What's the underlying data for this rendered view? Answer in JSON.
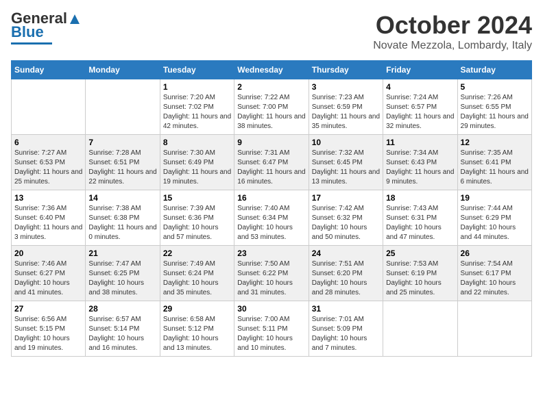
{
  "header": {
    "logo_general": "General",
    "logo_blue": "Blue",
    "month_title": "October 2024",
    "location": "Novate Mezzola, Lombardy, Italy"
  },
  "days_of_week": [
    "Sunday",
    "Monday",
    "Tuesday",
    "Wednesday",
    "Thursday",
    "Friday",
    "Saturday"
  ],
  "weeks": [
    [
      {
        "day": "",
        "info": ""
      },
      {
        "day": "",
        "info": ""
      },
      {
        "day": "1",
        "info": "Sunrise: 7:20 AM\nSunset: 7:02 PM\nDaylight: 11 hours and 42 minutes."
      },
      {
        "day": "2",
        "info": "Sunrise: 7:22 AM\nSunset: 7:00 PM\nDaylight: 11 hours and 38 minutes."
      },
      {
        "day": "3",
        "info": "Sunrise: 7:23 AM\nSunset: 6:59 PM\nDaylight: 11 hours and 35 minutes."
      },
      {
        "day": "4",
        "info": "Sunrise: 7:24 AM\nSunset: 6:57 PM\nDaylight: 11 hours and 32 minutes."
      },
      {
        "day": "5",
        "info": "Sunrise: 7:26 AM\nSunset: 6:55 PM\nDaylight: 11 hours and 29 minutes."
      }
    ],
    [
      {
        "day": "6",
        "info": "Sunrise: 7:27 AM\nSunset: 6:53 PM\nDaylight: 11 hours and 25 minutes."
      },
      {
        "day": "7",
        "info": "Sunrise: 7:28 AM\nSunset: 6:51 PM\nDaylight: 11 hours and 22 minutes."
      },
      {
        "day": "8",
        "info": "Sunrise: 7:30 AM\nSunset: 6:49 PM\nDaylight: 11 hours and 19 minutes."
      },
      {
        "day": "9",
        "info": "Sunrise: 7:31 AM\nSunset: 6:47 PM\nDaylight: 11 hours and 16 minutes."
      },
      {
        "day": "10",
        "info": "Sunrise: 7:32 AM\nSunset: 6:45 PM\nDaylight: 11 hours and 13 minutes."
      },
      {
        "day": "11",
        "info": "Sunrise: 7:34 AM\nSunset: 6:43 PM\nDaylight: 11 hours and 9 minutes."
      },
      {
        "day": "12",
        "info": "Sunrise: 7:35 AM\nSunset: 6:41 PM\nDaylight: 11 hours and 6 minutes."
      }
    ],
    [
      {
        "day": "13",
        "info": "Sunrise: 7:36 AM\nSunset: 6:40 PM\nDaylight: 11 hours and 3 minutes."
      },
      {
        "day": "14",
        "info": "Sunrise: 7:38 AM\nSunset: 6:38 PM\nDaylight: 11 hours and 0 minutes."
      },
      {
        "day": "15",
        "info": "Sunrise: 7:39 AM\nSunset: 6:36 PM\nDaylight: 10 hours and 57 minutes."
      },
      {
        "day": "16",
        "info": "Sunrise: 7:40 AM\nSunset: 6:34 PM\nDaylight: 10 hours and 53 minutes."
      },
      {
        "day": "17",
        "info": "Sunrise: 7:42 AM\nSunset: 6:32 PM\nDaylight: 10 hours and 50 minutes."
      },
      {
        "day": "18",
        "info": "Sunrise: 7:43 AM\nSunset: 6:31 PM\nDaylight: 10 hours and 47 minutes."
      },
      {
        "day": "19",
        "info": "Sunrise: 7:44 AM\nSunset: 6:29 PM\nDaylight: 10 hours and 44 minutes."
      }
    ],
    [
      {
        "day": "20",
        "info": "Sunrise: 7:46 AM\nSunset: 6:27 PM\nDaylight: 10 hours and 41 minutes."
      },
      {
        "day": "21",
        "info": "Sunrise: 7:47 AM\nSunset: 6:25 PM\nDaylight: 10 hours and 38 minutes."
      },
      {
        "day": "22",
        "info": "Sunrise: 7:49 AM\nSunset: 6:24 PM\nDaylight: 10 hours and 35 minutes."
      },
      {
        "day": "23",
        "info": "Sunrise: 7:50 AM\nSunset: 6:22 PM\nDaylight: 10 hours and 31 minutes."
      },
      {
        "day": "24",
        "info": "Sunrise: 7:51 AM\nSunset: 6:20 PM\nDaylight: 10 hours and 28 minutes."
      },
      {
        "day": "25",
        "info": "Sunrise: 7:53 AM\nSunset: 6:19 PM\nDaylight: 10 hours and 25 minutes."
      },
      {
        "day": "26",
        "info": "Sunrise: 7:54 AM\nSunset: 6:17 PM\nDaylight: 10 hours and 22 minutes."
      }
    ],
    [
      {
        "day": "27",
        "info": "Sunrise: 6:56 AM\nSunset: 5:15 PM\nDaylight: 10 hours and 19 minutes."
      },
      {
        "day": "28",
        "info": "Sunrise: 6:57 AM\nSunset: 5:14 PM\nDaylight: 10 hours and 16 minutes."
      },
      {
        "day": "29",
        "info": "Sunrise: 6:58 AM\nSunset: 5:12 PM\nDaylight: 10 hours and 13 minutes."
      },
      {
        "day": "30",
        "info": "Sunrise: 7:00 AM\nSunset: 5:11 PM\nDaylight: 10 hours and 10 minutes."
      },
      {
        "day": "31",
        "info": "Sunrise: 7:01 AM\nSunset: 5:09 PM\nDaylight: 10 hours and 7 minutes."
      },
      {
        "day": "",
        "info": ""
      },
      {
        "day": "",
        "info": ""
      }
    ]
  ]
}
